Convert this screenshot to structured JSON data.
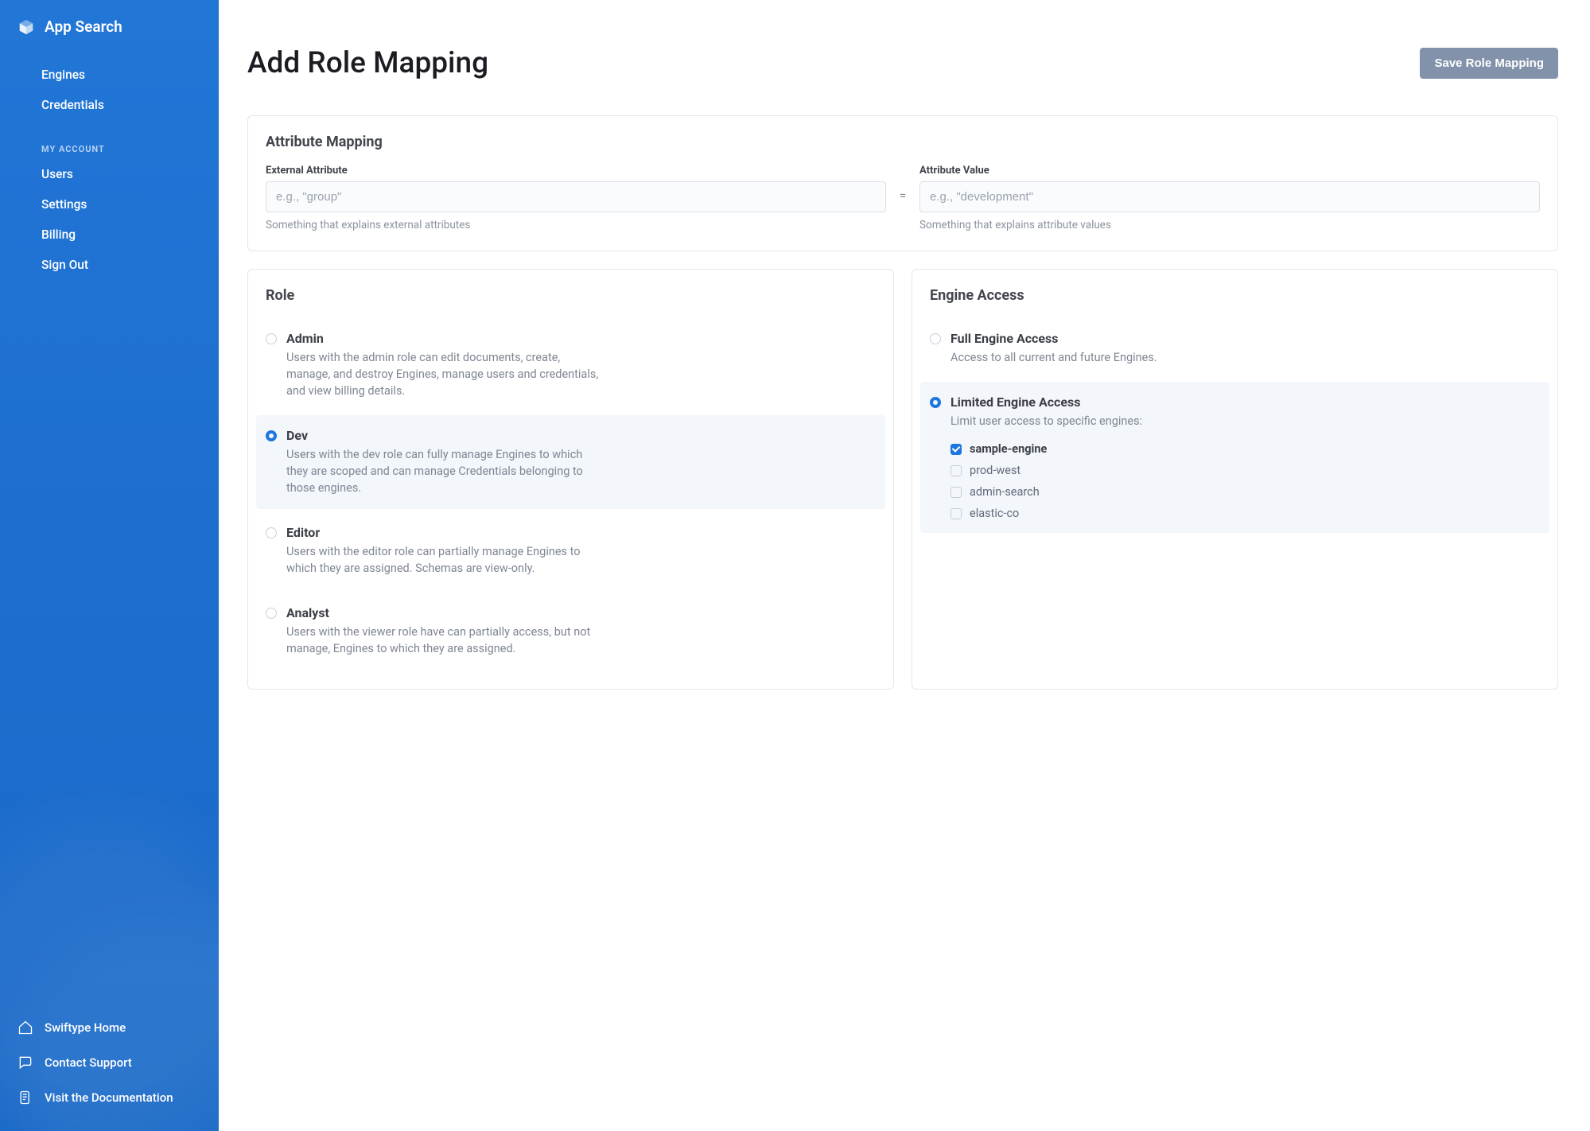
{
  "brand": {
    "title": "App Search"
  },
  "nav": {
    "main": [
      "Engines",
      "Credentials"
    ],
    "account_label": "MY ACCOUNT",
    "account": [
      "Users",
      "Settings",
      "Billing",
      "Sign Out"
    ]
  },
  "footer": [
    {
      "label": "Swiftype Home"
    },
    {
      "label": "Contact Support"
    },
    {
      "label": "Visit the Documentation"
    }
  ],
  "page": {
    "title": "Add Role Mapping",
    "save_label": "Save Role Mapping"
  },
  "attribute": {
    "panel_title": "Attribute Mapping",
    "external_label": "External Attribute",
    "external_placeholder": "e.g., \"group\"",
    "external_help": "Something that explains external attributes",
    "equals": "=",
    "value_label": "Attribute Value",
    "value_placeholder": "e.g., \"development\"",
    "value_help": "Something that explains attribute values"
  },
  "role": {
    "panel_title": "Role",
    "selected": "Dev",
    "options": [
      {
        "title": "Admin",
        "desc": "Users with the admin role can edit documents, create, manage, and destroy Engines, manage users and credentials, and view billing details."
      },
      {
        "title": "Dev",
        "desc": "Users with the dev role can fully manage Engines to which they are scoped and can manage Credentials belonging to those engines."
      },
      {
        "title": "Editor",
        "desc": "Users with the editor role can partially manage Engines to which they are assigned. Schemas are view-only."
      },
      {
        "title": "Analyst",
        "desc": "Users with the viewer role have can partially access, but not manage, Engines to which they are assigned."
      }
    ]
  },
  "access": {
    "panel_title": "Engine Access",
    "selected": "limited",
    "full": {
      "title": "Full Engine Access",
      "desc": "Access to all current and future Engines."
    },
    "limited": {
      "title": "Limited Engine Access",
      "desc": "Limit user access to specific engines:"
    },
    "engines": [
      {
        "name": "sample-engine",
        "checked": true
      },
      {
        "name": "prod-west",
        "checked": false
      },
      {
        "name": "admin-search",
        "checked": false
      },
      {
        "name": "elastic-co",
        "checked": false
      }
    ]
  }
}
